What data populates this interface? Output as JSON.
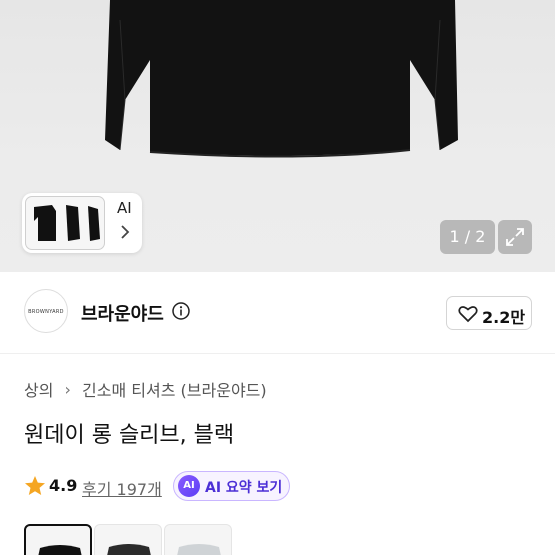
{
  "gallery": {
    "pager": "1 / 2",
    "thumb_label": "AI",
    "icons": [
      "chevron-right-icon",
      "expand-icon"
    ]
  },
  "brand": {
    "logo_text": "BROWNYARD",
    "name": "브라운야드",
    "likes": "2.2만",
    "icons": [
      "info-icon",
      "heart-icon"
    ]
  },
  "breadcrumb": {
    "items": [
      "상의",
      "긴소매 티셔츠 (브라운야드)"
    ]
  },
  "product": {
    "title": "원데이 롱 슬리브, 블랙"
  },
  "rating": {
    "score": "4.9",
    "reviews": "후기 197개",
    "ai_badge": "AI",
    "ai_summary": "AI 요약 보기"
  },
  "colors": {
    "options": [
      "black",
      "charcoal",
      "light-gray"
    ],
    "selected": "black",
    "hex": {
      "black": "#111111",
      "charcoal": "#2b2b2b",
      "light-gray": "#cfd3d6"
    }
  },
  "accent": {
    "ai": "#5b3df5",
    "star": "#f5a623"
  }
}
